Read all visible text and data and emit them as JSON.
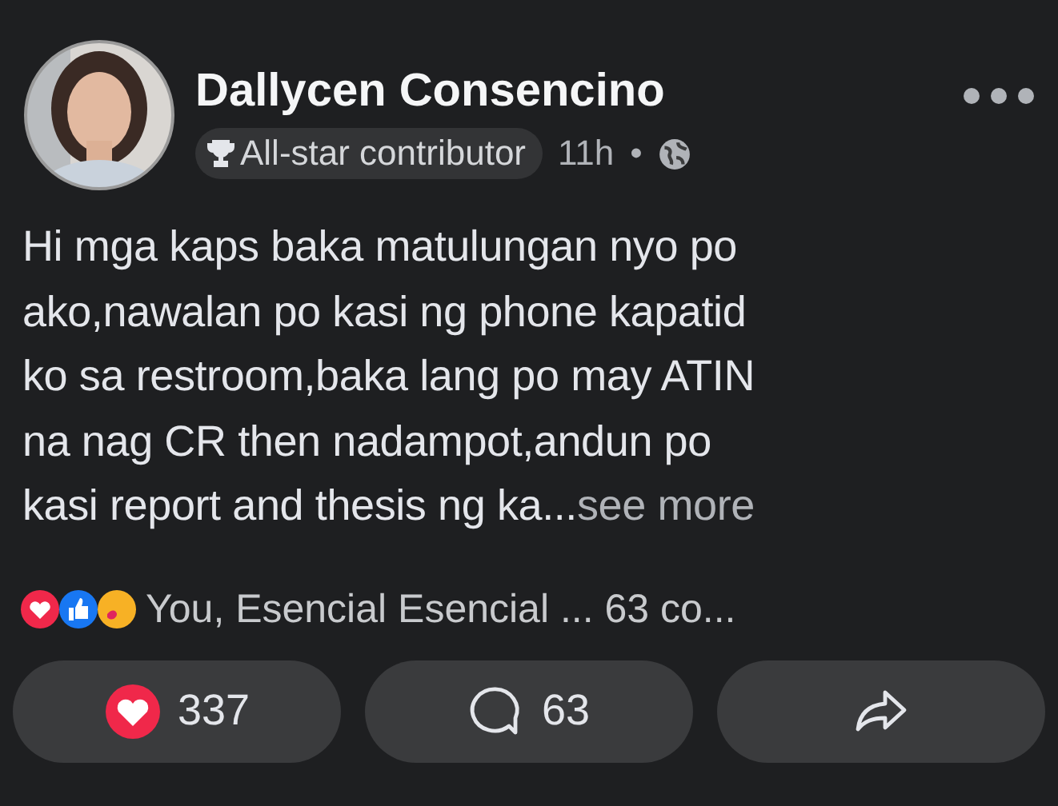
{
  "post": {
    "author": "Dallycen Consencino",
    "badge": "All-star contributor",
    "time": "11h",
    "separator": "•",
    "text_lines": [
      "Hi mga kaps baka matulungan nyo po",
      "ako,nawalan po kasi ng phone kapatid",
      "ko sa restroom,baka lang po may ATIN",
      "na nag CR then nadampot,andun po",
      "kasi report and thesis ng ka..."
    ],
    "see_more": "see more",
    "reactions_summary": "You, Esencial Esencial ... 63 co..."
  },
  "actions": [
    {
      "kind": "react",
      "count": "337"
    },
    {
      "kind": "comment",
      "count": "63"
    },
    {
      "kind": "share"
    }
  ]
}
